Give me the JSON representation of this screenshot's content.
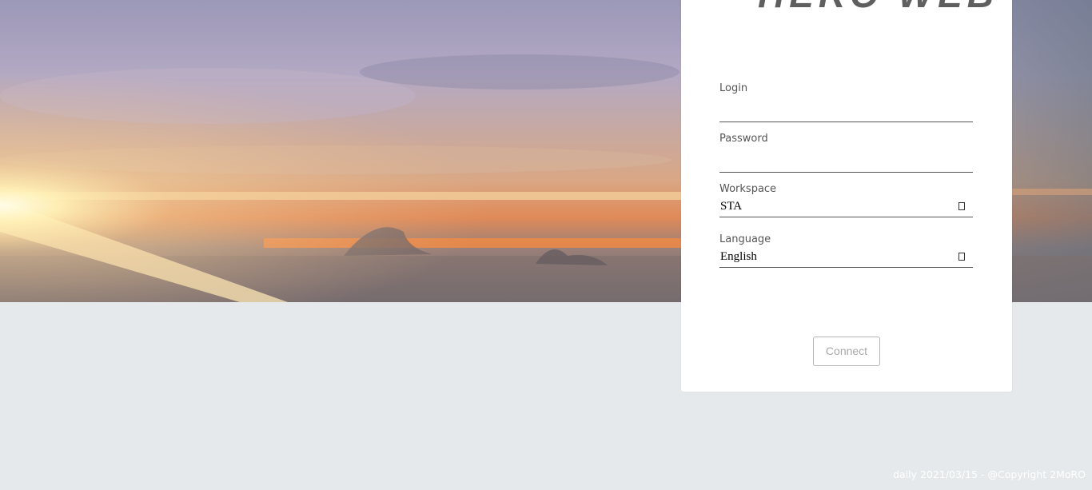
{
  "logo": {
    "text": "HERO WEBB"
  },
  "login_form": {
    "login_label": "Login",
    "login_value": "",
    "password_label": "Password",
    "password_value": "",
    "workspace_label": "Workspace",
    "workspace_value": "STA",
    "language_label": "Language",
    "language_value": "English",
    "connect_label": "Connect"
  },
  "footer": {
    "text": "daily 2021/03/15 - @Copyright 2MoRO"
  },
  "colors": {
    "background": "#e6e9eb",
    "card": "#ffffff",
    "button_text": "#a8a8a8",
    "label_text": "#555555"
  },
  "icons": {
    "select_arrow": "dropdown-arrow-icon",
    "logo_mark": "circle-logo-icon"
  }
}
